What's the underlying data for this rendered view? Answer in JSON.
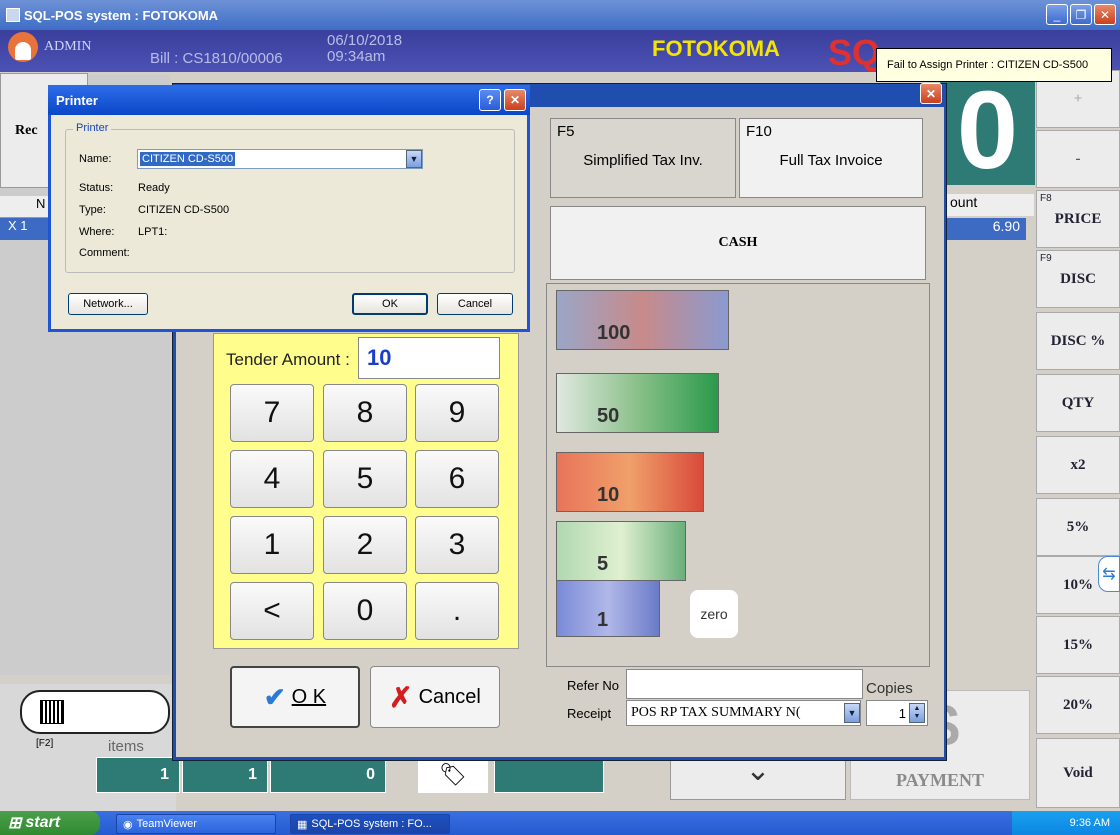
{
  "window": {
    "title": "SQL-POS system : FOTOKOMA",
    "min": "_",
    "max": "❐",
    "close": "✕"
  },
  "header": {
    "user": "ADMIN",
    "bill": "Bill : CS1810/00006",
    "date": "06/10/2018",
    "time": "09:34am",
    "brand": "FOTOKOMA",
    "brand_logo": "SQ"
  },
  "tooltip": "Fail to Assign Printer : CITIZEN CD-S500",
  "main": {
    "total_display": "0",
    "receipt_btn": "Rec",
    "grid_header": "N",
    "row_mark": "X  1",
    "amount_header": "ount",
    "amount_value": "6.90"
  },
  "right_buttons": [
    {
      "key": "",
      "label": "+"
    },
    {
      "key": "",
      "label": "-"
    },
    {
      "key": "F8",
      "label": "PRICE"
    },
    {
      "key": "F9",
      "label": "DISC"
    },
    {
      "key": "",
      "label": "DISC %"
    },
    {
      "key": "",
      "label": "QTY"
    },
    {
      "key": "",
      "label": "x2"
    },
    {
      "key": "",
      "label": "5%"
    },
    {
      "key": "",
      "label": "10%"
    },
    {
      "key": "",
      "label": "15%"
    },
    {
      "key": "",
      "label": "20%"
    },
    {
      "key": "",
      "label": "Void"
    }
  ],
  "bottom": {
    "f2": "[F2]",
    "items_label": "items",
    "counts": [
      "1",
      "1",
      "0"
    ],
    "payment": "PAYMENT",
    "dollar": "$",
    "chevron": "⌄"
  },
  "payment_dialog": {
    "close": "✕",
    "tax_simplified": {
      "key": "F5",
      "label": "Simplified Tax Inv."
    },
    "tax_full": {
      "key": "F10",
      "label": "Full Tax Invoice"
    },
    "cash": "CASH",
    "notes": [
      "100",
      "50",
      "10",
      "5",
      "1"
    ],
    "zero": "zero",
    "tender_label": "Tender Amount :",
    "tender_value": "10",
    "keys": [
      "7",
      "8",
      "9",
      "4",
      "5",
      "6",
      "1",
      "2",
      "3",
      "<",
      "0",
      "."
    ],
    "ok": "O K",
    "ok_icon": "✔",
    "cancel": "Cancel",
    "cancel_icon": "✗",
    "refer_label": "Refer No",
    "refer_value": "",
    "copies_label": "Copies",
    "copies_value": "1",
    "receipt_label": "Receipt",
    "receipt_value": "POS RP TAX SUMMARY N("
  },
  "printer_dialog": {
    "title": "Printer",
    "help": "?",
    "close": "✕",
    "group": "Printer",
    "name_label": "Name:",
    "name_value": "CITIZEN CD-S500",
    "status_label": "Status:",
    "status_value": "Ready",
    "type_label": "Type:",
    "type_value": "CITIZEN CD-S500",
    "where_label": "Where:",
    "where_value": "LPT1:",
    "comment_label": "Comment:",
    "comment_value": "",
    "network": "Network...",
    "ok": "OK",
    "cancel": "Cancel"
  },
  "taskbar": {
    "start": "start",
    "tasks": [
      "TeamViewer",
      "SQL-POS system : FO..."
    ],
    "clock": "9:36 AM"
  },
  "colors": {
    "teal": "#2e7a74",
    "xp_blue": "#1e55d6",
    "keypad_bg": "#fffd8c",
    "brand_yellow": "#f5e400"
  }
}
